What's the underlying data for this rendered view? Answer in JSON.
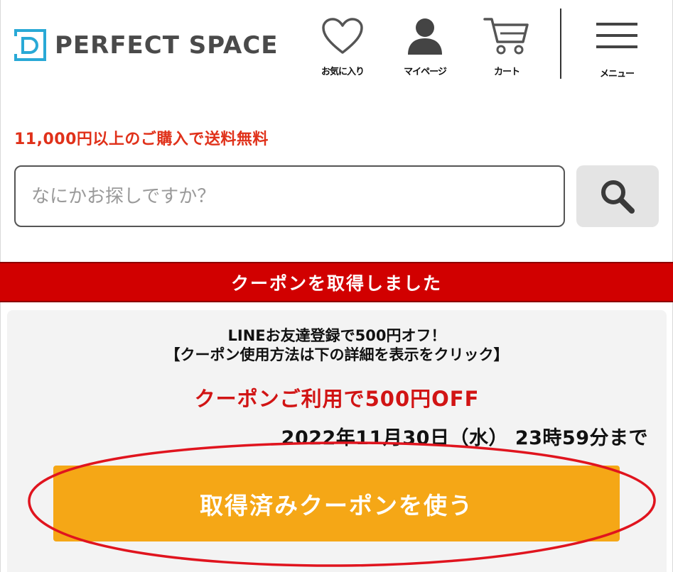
{
  "header": {
    "logo_text": "PERFECT SPACE",
    "nav": [
      {
        "label": "お気に入り",
        "icon": "heart-icon"
      },
      {
        "label": "マイページ",
        "icon": "user-icon"
      },
      {
        "label": "カート",
        "icon": "cart-icon"
      },
      {
        "label": "メニュー",
        "icon": "hamburger-menu-icon"
      }
    ]
  },
  "shipping_notice": "11,000円以上のご購入で送料無料",
  "search": {
    "placeholder": "なにかお探しですか？",
    "button_icon": "search-icon"
  },
  "coupon": {
    "banner": "クーポンを取得しました",
    "title": "LINEお友達登録で500円オフ！",
    "instruction": "【クーポン使用方法は下の詳細を表示をクリック】",
    "offer": "クーポンご利用で500円OFF",
    "expiry": "2022年11月30日（水） 23時59分まで",
    "button_label": "取得済みクーポンを使う"
  },
  "colors": {
    "accent_red": "#d10000",
    "notice_red": "#e0311a",
    "button_orange": "#f5a716",
    "annotation_red": "#e0141e",
    "logo_blue": "#29a9d6"
  }
}
